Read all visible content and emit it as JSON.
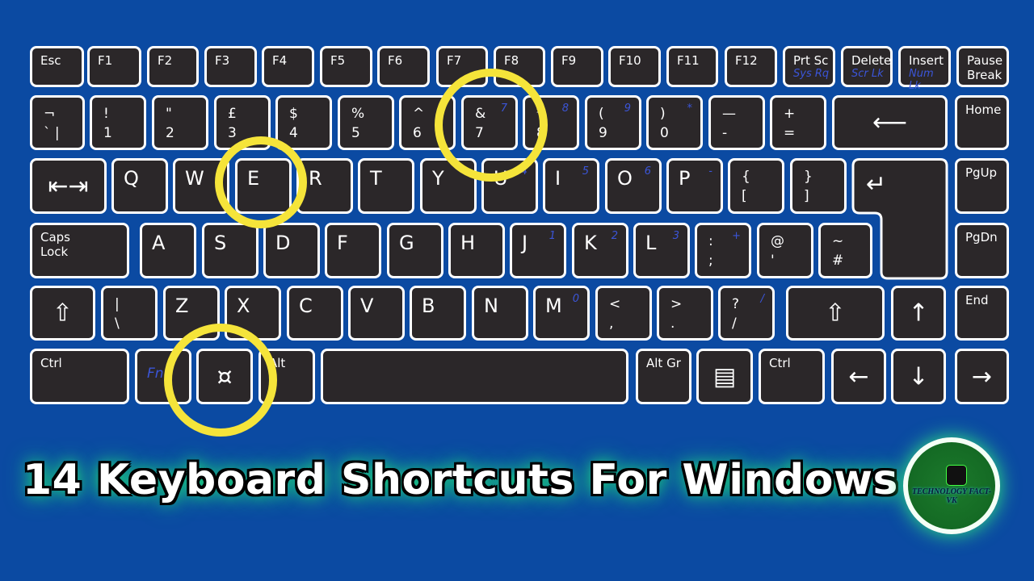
{
  "colors": {
    "background": "#0b4aa2",
    "key": "#2b2729",
    "key_border": "#ffffff",
    "secondary_label": "#3b55d8",
    "highlight_circle": "#f5e43a"
  },
  "keyboard": {
    "rows": [
      [
        {
          "small": "Esc"
        },
        {
          "small": "F1"
        },
        {
          "small": "F2"
        },
        {
          "small": "F3"
        },
        {
          "small": "F4"
        },
        {
          "small": "F5"
        },
        {
          "small": "F6"
        },
        {
          "small": "F7"
        },
        {
          "small": "F8"
        },
        {
          "small": "F9"
        },
        {
          "small": "F10"
        },
        {
          "small": "F11"
        },
        {
          "small": "F12"
        },
        {
          "small": "Prt Sc",
          "subb": "Sys Rq"
        },
        {
          "small": "Delete",
          "subb": "Scr Lk"
        },
        {
          "small": "Insert",
          "subb": "Num Lk"
        },
        {
          "small": "Pause\nBreak"
        }
      ],
      [
        {
          "top": "¬",
          "bottom": "`   |"
        },
        {
          "top": "!",
          "bottom": "1"
        },
        {
          "top": "\"",
          "bottom": "2"
        },
        {
          "top": "£",
          "bottom": "3"
        },
        {
          "top": "$",
          "bottom": "4"
        },
        {
          "top": "%",
          "bottom": "5"
        },
        {
          "top": "^",
          "bottom": "6"
        },
        {
          "top": "&",
          "bottom": "7",
          "sub": "7"
        },
        {
          "top": "*",
          "bottom": "8",
          "sub": "8"
        },
        {
          "top": "(",
          "bottom": "9",
          "sub": "9"
        },
        {
          "top": ")",
          "bottom": "0",
          "sub": "*"
        },
        {
          "top": "—",
          "bottom": "-"
        },
        {
          "top": "+",
          "bottom": "="
        },
        {
          "icon": "⟵",
          "icon_name": "backspace-icon"
        },
        {
          "small": "Home"
        }
      ],
      [
        {
          "icon": "⇤⇥",
          "icon_name": "tab-icon"
        },
        {
          "main": "Q"
        },
        {
          "main": "W"
        },
        {
          "main": "E"
        },
        {
          "main": "R"
        },
        {
          "main": "T"
        },
        {
          "main": "Y"
        },
        {
          "main": "U",
          "sub": "4"
        },
        {
          "main": "I",
          "sub": "5"
        },
        {
          "main": "O",
          "sub": "6"
        },
        {
          "main": "P",
          "sub": "-"
        },
        {
          "top": "{",
          "bottom": "["
        },
        {
          "top": "}",
          "bottom": "]"
        },
        {
          "small": "PgUp"
        }
      ],
      [
        {
          "small": "Caps\nLock"
        },
        {
          "main": "A"
        },
        {
          "main": "S"
        },
        {
          "main": "D"
        },
        {
          "main": "F"
        },
        {
          "main": "G"
        },
        {
          "main": "H"
        },
        {
          "main": "J",
          "sub": "1"
        },
        {
          "main": "K",
          "sub": "2"
        },
        {
          "main": "L",
          "sub": "3"
        },
        {
          "top": ":",
          "bottom": ";",
          "sub": "+"
        },
        {
          "top": "@",
          "bottom": "'"
        },
        {
          "top": "~",
          "bottom": "#"
        },
        {
          "small": "PgDn"
        }
      ],
      [
        {
          "icon": "⇧",
          "icon_name": "shift-icon"
        },
        {
          "top": "|",
          "bottom": "\\"
        },
        {
          "main": "Z"
        },
        {
          "main": "X"
        },
        {
          "main": "C"
        },
        {
          "main": "V"
        },
        {
          "main": "B"
        },
        {
          "main": "N"
        },
        {
          "main": "M",
          "sub": "0"
        },
        {
          "top": "<",
          "bottom": ","
        },
        {
          "top": ">",
          "bottom": "."
        },
        {
          "top": "?",
          "bottom": "/",
          "sub": "/"
        },
        {
          "icon": "⇧",
          "icon_name": "shift-icon"
        },
        {
          "icon": "↑",
          "icon_name": "arrow-up-icon"
        },
        {
          "small": "End"
        }
      ],
      [
        {
          "small": "Ctrl"
        },
        {
          "fn": "Fn"
        },
        {
          "icon": "¤",
          "icon_name": "windows-icon"
        },
        {
          "small": "Alt"
        },
        {
          "main": ""
        },
        {
          "small": "Alt Gr"
        },
        {
          "icon": "▤",
          "icon_name": "menu-icon"
        },
        {
          "small": "Ctrl"
        },
        {
          "icon": "←",
          "icon_name": "arrow-left-icon"
        },
        {
          "icon": "↓",
          "icon_name": "arrow-down-icon"
        },
        {
          "icon": "→",
          "icon_name": "arrow-right-icon"
        }
      ]
    ],
    "enter_icon": "↵",
    "highlighted_keys": [
      "E",
      "7",
      "Windows"
    ]
  },
  "title": "14 Keyboard Shortcuts For Windows",
  "logo": {
    "text": "TECHNOLOGY FACT-VK"
  }
}
